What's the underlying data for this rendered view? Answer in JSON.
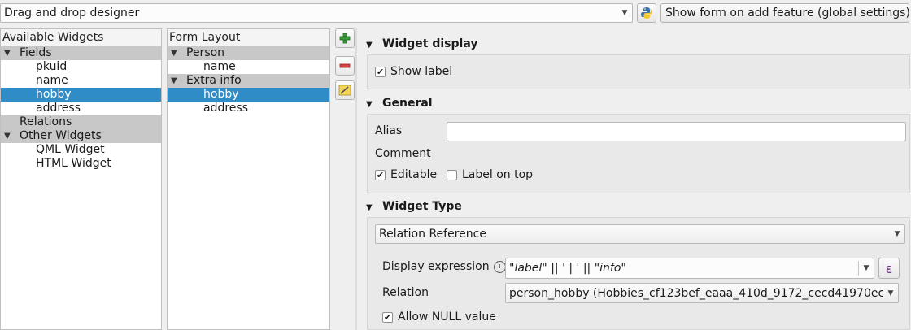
{
  "toolbar": {
    "designer_mode": "Drag and drop designer",
    "python_icon": "python-icon",
    "show_form_option": "Show form on add feature (global settings)"
  },
  "available_widgets": {
    "header": "Available Widgets",
    "fields_label": "Fields",
    "fields": [
      "pkuid",
      "name",
      "hobby",
      "address"
    ],
    "relations_label": "Relations",
    "other_label": "Other Widgets",
    "other": [
      "QML Widget",
      "HTML Widget"
    ]
  },
  "form_layout": {
    "header": "Form Layout",
    "group1_label": "Person",
    "group1_items": [
      "name"
    ],
    "group2_label": "Extra info",
    "group2_items": [
      "hobby",
      "address"
    ]
  },
  "side_buttons": [
    "add-icon",
    "remove-icon",
    "edit-icon"
  ],
  "widget_display": {
    "title": "Widget display",
    "show_label": "Show label",
    "show_label_checked": true
  },
  "general": {
    "title": "General",
    "alias_label": "Alias",
    "alias_value": "",
    "comment_label": "Comment",
    "editable_label": "Editable",
    "editable_checked": true,
    "label_on_top": "Label on top",
    "label_on_top_checked": false
  },
  "widget_type": {
    "title": "Widget Type",
    "selected": "Relation Reference",
    "display_expression_label": "Display expression",
    "display_expression_value": "\"label\" || ' | ' || \"info\"",
    "relation_label": "Relation",
    "relation_value": "person_hobby (Hobbies_cf123bef_eaaa_410d_9172_cecd41970ecb",
    "allow_null_label": "Allow NULL value",
    "allow_null_checked": true
  },
  "colors": {
    "selection": "#308cc6",
    "category_bg": "#c8c8c8"
  }
}
